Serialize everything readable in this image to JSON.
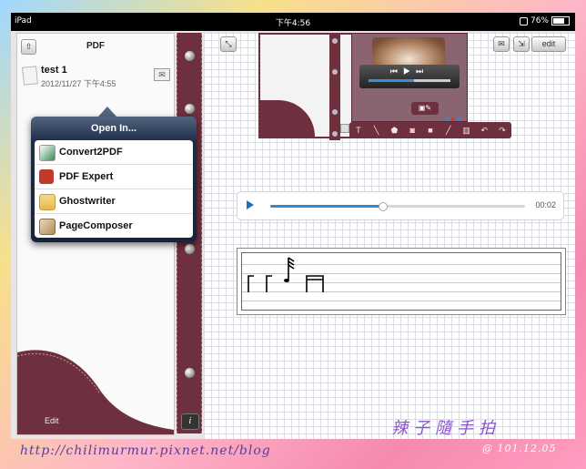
{
  "status_bar": {
    "device": "iPad",
    "time": "下午4:56",
    "battery": "76%"
  },
  "left_pane": {
    "title": "PDF",
    "up_icon": "up-folder-icon",
    "doc_name": "test 1",
    "doc_date": "2012/11/27 下午4:55",
    "edit_label": "Edit"
  },
  "popover": {
    "title": "Open In...",
    "items": [
      {
        "label": "Convert2PDF",
        "icon": "convert2pdf-icon",
        "color": "#3a8c5a"
      },
      {
        "label": "PDF Expert",
        "icon": "pdf-expert-icon",
        "color": "#c0392b"
      },
      {
        "label": "Ghostwriter",
        "icon": "ghostwriter-icon",
        "color": "#e8b84a"
      },
      {
        "label": "PageComposer",
        "icon": "pagecomposer-icon",
        "color": "#b48c5a"
      }
    ]
  },
  "info_button": "i",
  "toolbar": {
    "edit_label": "edit"
  },
  "audio": {
    "time": "00:02",
    "progress": 0.44
  },
  "watermark": "http://chilimurmur.pixnet.net/blog",
  "stamp_text": "辣子隨手拍",
  "stamp_date": "@ 101.12.05",
  "colors": {
    "leather": "#6e2f3e",
    "accent": "#2e8bd0",
    "popover": "#1d2d47"
  }
}
